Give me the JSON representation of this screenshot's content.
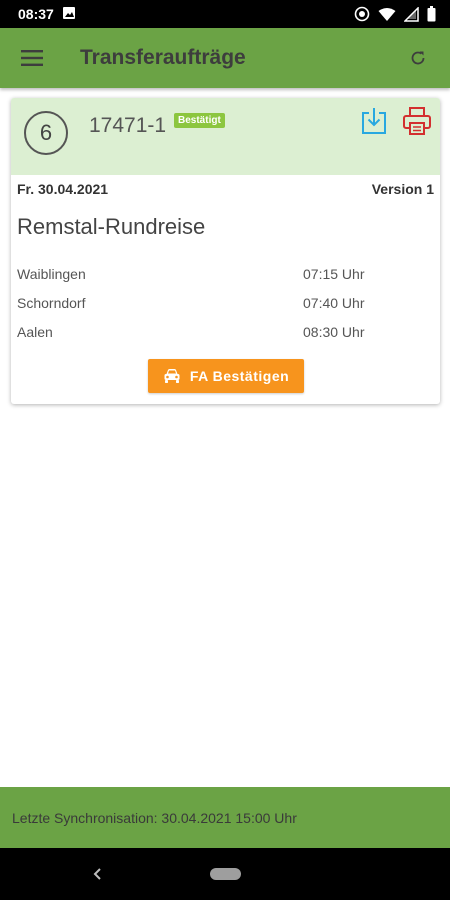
{
  "status_bar": {
    "time": "08:37",
    "icons": [
      "image-icon",
      "sync-status-icon",
      "wifi-icon",
      "signal-icon",
      "battery-icon"
    ]
  },
  "app_bar": {
    "title": "Transferaufträge",
    "menu_icon": "menu-icon",
    "refresh_icon": "refresh-icon",
    "color": "#6ba345"
  },
  "order": {
    "count": "6",
    "number": "17471-1",
    "status": "Bestätigt",
    "status_color": "#8cc63f",
    "header_color": "#dcefd2",
    "date": "Fr. 30.04.2021",
    "version": "Version 1",
    "title": "Remstal-Rundreise",
    "stops": [
      {
        "name": "Waiblingen",
        "time": "07:15 Uhr"
      },
      {
        "name": "Schorndorf",
        "time": "07:40 Uhr"
      },
      {
        "name": "Aalen",
        "time": "08:30 Uhr"
      }
    ],
    "confirm_label": "FA Bestätigen",
    "confirm_color": "#f7941d",
    "download_icon": "download-icon",
    "print_icon": "print-icon",
    "download_color": "#29a8e0",
    "print_color": "#d32f2f"
  },
  "footer": {
    "sync_text": "Letzte Synchronisation: 30.04.2021 15:00 Uhr"
  },
  "nav": {
    "back_icon": "back-icon",
    "home_icon": "home-pill-icon"
  }
}
